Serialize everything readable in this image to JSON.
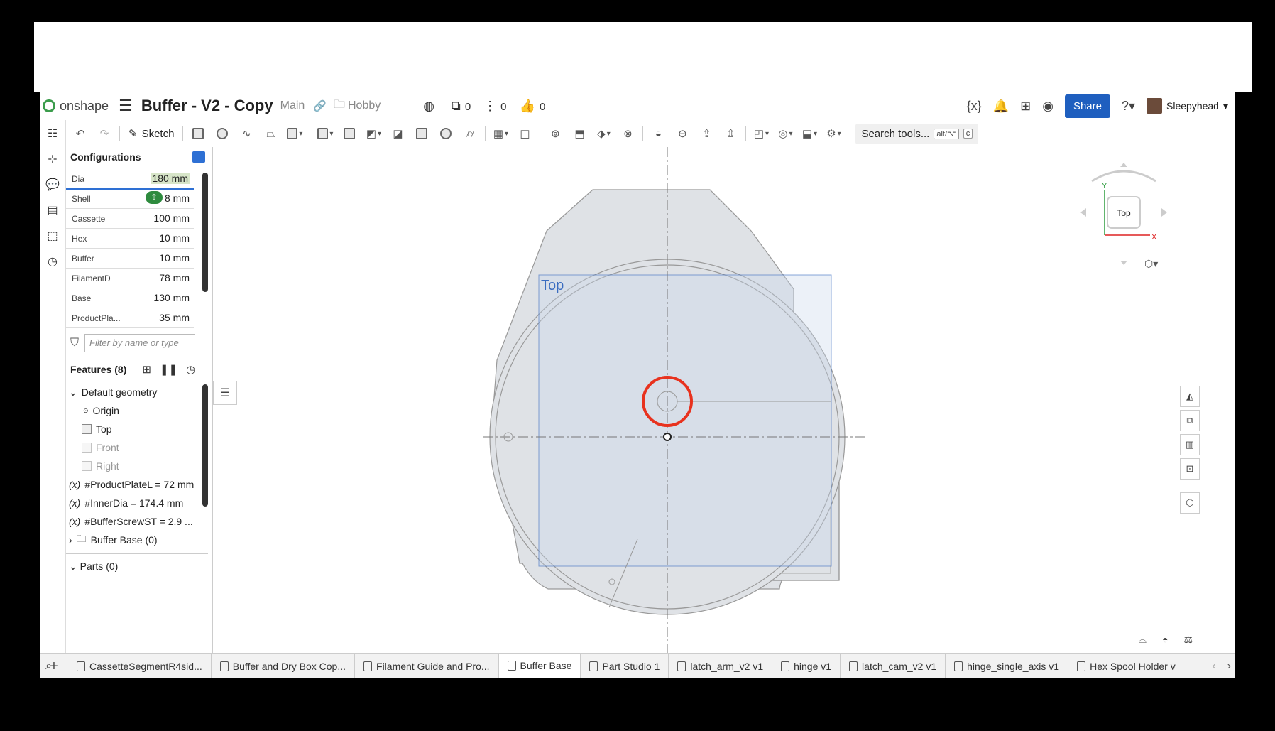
{
  "header": {
    "logo_text": "onshape",
    "doc_title": "Buffer - V2 - Copy",
    "branch": "Main",
    "folder": "Hobby",
    "count_versions": "0",
    "count_branches": "0",
    "count_likes": "0",
    "share_label": "Share",
    "user_name": "Sleepyhead"
  },
  "toolbar": {
    "sketch_label": "Sketch",
    "search_label": "Search tools...",
    "search_kbd1": "alt/⌥",
    "search_kbd2": "c"
  },
  "config": {
    "title": "Configurations",
    "rows": [
      {
        "label": "Dia",
        "value": "180 mm"
      },
      {
        "label": "Shell",
        "value": "8 mm"
      },
      {
        "label": "Cassette",
        "value": "100 mm"
      },
      {
        "label": "Hex",
        "value": "10 mm"
      },
      {
        "label": "Buffer",
        "value": "10 mm"
      },
      {
        "label": "FilamentD",
        "value": "78 mm"
      },
      {
        "label": "Base",
        "value": "130 mm"
      },
      {
        "label": "ProductPla...",
        "value": "35 mm"
      }
    ]
  },
  "filter": {
    "placeholder": "Filter by name or type"
  },
  "features": {
    "title": "Features (8)",
    "default_geometry": "Default geometry",
    "origin": "Origin",
    "top": "Top",
    "front": "Front",
    "right": "Right",
    "var1": "#ProductPlateL = 72 mm",
    "var2": "#InnerDia = 174.4 mm",
    "var3": "#BufferScrewST = 2.9 ...",
    "folder": "Buffer Base (0)",
    "parts": "Parts (0)"
  },
  "canvas": {
    "plane_label": "Top",
    "viewcube_label": "Top",
    "axis_y": "Y",
    "axis_x": "X",
    "highlight_color": "#e8321e",
    "plane_color": "#3a6cc0"
  },
  "tabs": [
    {
      "label": "CassetteSegmentR4sid...",
      "active": false
    },
    {
      "label": "Buffer and Dry Box Cop...",
      "active": false
    },
    {
      "label": "Filament Guide and Pro...",
      "active": false
    },
    {
      "label": "Buffer Base",
      "active": true
    },
    {
      "label": "Part Studio 1",
      "active": false
    },
    {
      "label": "latch_arm_v2 v1",
      "active": false
    },
    {
      "label": "hinge v1",
      "active": false
    },
    {
      "label": "latch_cam_v2 v1",
      "active": false
    },
    {
      "label": "hinge_single_axis v1",
      "active": false
    },
    {
      "label": "Hex Spool Holder v",
      "active": false
    }
  ]
}
